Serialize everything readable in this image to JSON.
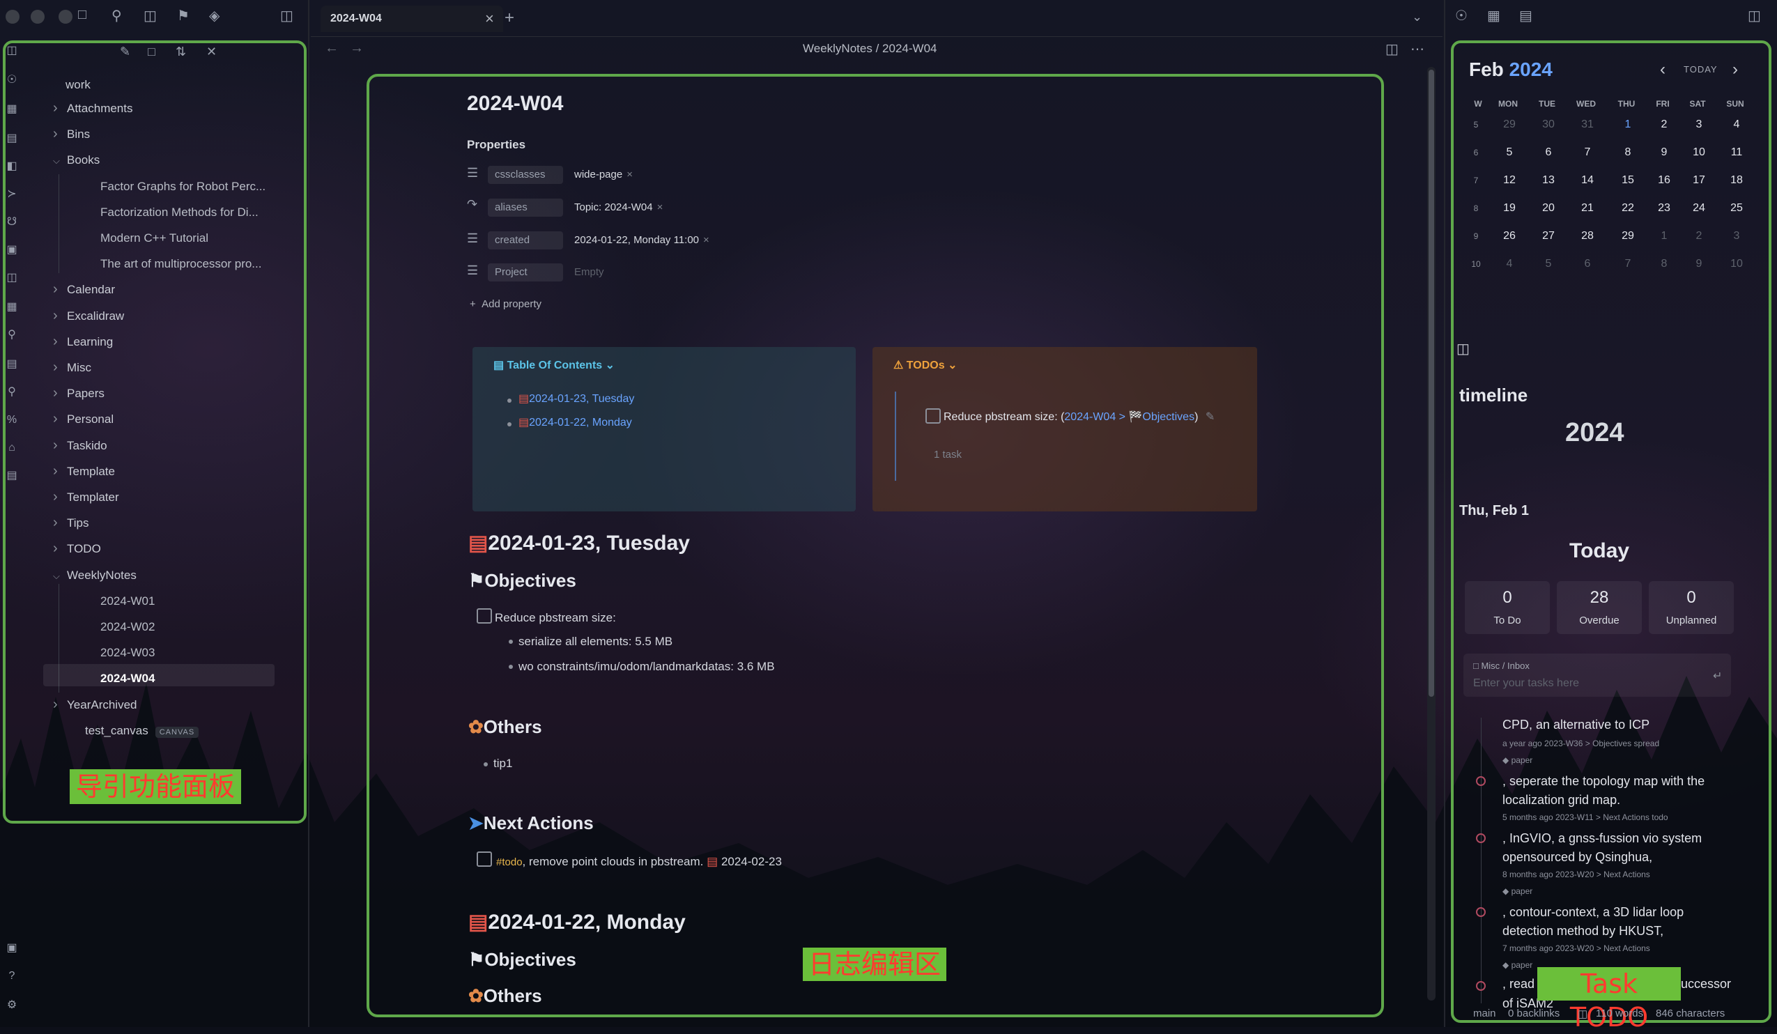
{
  "left_panel": {
    "vault_name": "work",
    "tree": [
      {
        "label": "Attachments",
        "type": "folder"
      },
      {
        "label": "Bins",
        "type": "folder"
      },
      {
        "label": "Books",
        "type": "folder-open"
      },
      {
        "label": "Factor Graphs for Robot Perc...",
        "type": "file"
      },
      {
        "label": "Factorization Methods for Di...",
        "type": "file"
      },
      {
        "label": "Modern C++ Tutorial",
        "type": "file"
      },
      {
        "label": "The art of multiprocessor pro...",
        "type": "file"
      },
      {
        "label": "Calendar",
        "type": "folder"
      },
      {
        "label": "Excalidraw",
        "type": "folder"
      },
      {
        "label": "Learning",
        "type": "folder"
      },
      {
        "label": "Misc",
        "type": "folder"
      },
      {
        "label": "Papers",
        "type": "folder"
      },
      {
        "label": "Personal",
        "type": "folder"
      },
      {
        "label": "Taskido",
        "type": "folder"
      },
      {
        "label": "Template",
        "type": "folder"
      },
      {
        "label": "Templater",
        "type": "folder"
      },
      {
        "label": "Tips",
        "type": "folder"
      },
      {
        "label": "TODO",
        "type": "folder"
      },
      {
        "label": "WeeklyNotes",
        "type": "folder-open"
      },
      {
        "label": "2024-W01",
        "type": "file"
      },
      {
        "label": "2024-W02",
        "type": "file"
      },
      {
        "label": "2024-W03",
        "type": "file"
      },
      {
        "label": "2024-W04",
        "type": "file-active"
      },
      {
        "label": "YearArchived",
        "type": "folder"
      },
      {
        "label": "test_canvas",
        "type": "canvas"
      }
    ],
    "canvas_badge": "CANVAS",
    "annotation": "导引功能面板"
  },
  "tabbar": {
    "active_tab": "2024-W04",
    "close": "×",
    "new_tab": "+"
  },
  "editor": {
    "breadcrumb_folder": "WeeklyNotes",
    "breadcrumb_sep": "/",
    "breadcrumb_file": "2024-W04",
    "title": "2024-W04",
    "properties_heading": "Properties",
    "properties": [
      {
        "key": "cssclasses",
        "value": "wide-page",
        "removable": true
      },
      {
        "key": "aliases",
        "value": "Topic: 2024-W04",
        "removable": true
      },
      {
        "key": "created",
        "value": "2024-01-22, Monday 11:00",
        "removable": true
      },
      {
        "key": "Project",
        "value": "Empty",
        "removable": false
      }
    ],
    "add_property": "Add property",
    "toc": {
      "title": "Table Of Contents",
      "items": [
        "2024-01-23, Tuesday",
        "2024-01-22, Monday"
      ]
    },
    "todos": {
      "title": "TODOs",
      "task_text": "Reduce pbstream size: (",
      "task_link": "2024-W04 > 🏁Objectives",
      "task_close": ")",
      "count": "1 task"
    },
    "sections": {
      "day1_heading": "2024-01-23, Tuesday",
      "objectives": "Objectives",
      "task1": "Reduce pbstream size:",
      "sub1": "serialize all elements: 5.5 MB",
      "sub2": "wo constraints/imu/odom/landmarkdatas: 3.6 MB",
      "others": "Others",
      "tip": "tip1",
      "next_actions": "Next Actions",
      "todo_tag": "#todo",
      "todo_text": ", remove point clouds in pbstream.",
      "todo_date": "2024-02-23",
      "day2_heading": "2024-01-22, Monday",
      "objectives2": "Objectives",
      "others2": "Others"
    },
    "annotation": "日志编辑区"
  },
  "right_panel": {
    "calendar": {
      "month": "Feb",
      "year": "2024",
      "today_button": "TODAY",
      "headers": [
        "W",
        "MON",
        "TUE",
        "WED",
        "THU",
        "FRI",
        "SAT",
        "SUN"
      ],
      "weeks": [
        {
          "w": "5",
          "days": [
            "29",
            "30",
            "31",
            "1",
            "2",
            "3",
            "4"
          ],
          "dim": [
            true,
            true,
            true,
            false,
            false,
            false,
            false
          ]
        },
        {
          "w": "6",
          "days": [
            "5",
            "6",
            "7",
            "8",
            "9",
            "10",
            "11"
          ],
          "dim": [
            false,
            false,
            false,
            false,
            false,
            false,
            false
          ]
        },
        {
          "w": "7",
          "days": [
            "12",
            "13",
            "14",
            "15",
            "16",
            "17",
            "18"
          ],
          "dim": [
            false,
            false,
            false,
            false,
            false,
            false,
            false
          ]
        },
        {
          "w": "8",
          "days": [
            "19",
            "20",
            "21",
            "22",
            "23",
            "24",
            "25"
          ],
          "dim": [
            false,
            false,
            false,
            false,
            false,
            false,
            false
          ]
        },
        {
          "w": "9",
          "days": [
            "26",
            "27",
            "28",
            "29",
            "1",
            "2",
            "3"
          ],
          "dim": [
            false,
            false,
            false,
            false,
            true,
            true,
            true
          ]
        },
        {
          "w": "10",
          "days": [
            "4",
            "5",
            "6",
            "7",
            "8",
            "9",
            "10"
          ],
          "dim": [
            true,
            true,
            true,
            true,
            true,
            true,
            true
          ]
        }
      ]
    },
    "timeline_label": "timeline",
    "year": "2024",
    "date": "Thu, Feb 1",
    "today": "Today",
    "stats": [
      {
        "n": "0",
        "label": "To Do"
      },
      {
        "n": "28",
        "label": "Overdue"
      },
      {
        "n": "0",
        "label": "Unplanned"
      }
    ],
    "input_path": "Misc / Inbox",
    "input_placeholder": "Enter your tasks here",
    "tasks": [
      {
        "title": "CPD, an alternative to ICP",
        "meta": "a year ago  2023-W36 > Objectives  spread",
        "tag": "paper"
      },
      {
        "title": ", seperate the topology map with the localization grid map.",
        "meta": "5 months ago  2023-W11 > Next Actions  todo",
        "tag": ""
      },
      {
        "title": ", InGVIO, a gnss-fussion vio system opensourced by Qsinghua,",
        "meta": "8 months ago  2023-W20 > Next Actions",
        "tag": "paper"
      },
      {
        "title": ", contour-context, a 3D lidar loop detection method by HKUST,",
        "meta": "7 months ago  2023-W20 > Next Actions",
        "tag": "paper"
      },
      {
        "title": ", read",
        "meta": "",
        "tag": ""
      }
    ],
    "task_tail": "uccessor",
    "task_tail2": "of iSAM2",
    "annotation": "Task TODO",
    "status": {
      "branch": "main",
      "backlinks": "0 backlinks",
      "words": "110 words",
      "chars": "846 characters"
    }
  },
  "colors": {
    "accent": "#6aa4ff",
    "annotation_border": "#5fa84a",
    "annotation_bg": "#6bbf3a",
    "annotation_text": "#ff3b2f",
    "tag": "#e8b64c"
  }
}
